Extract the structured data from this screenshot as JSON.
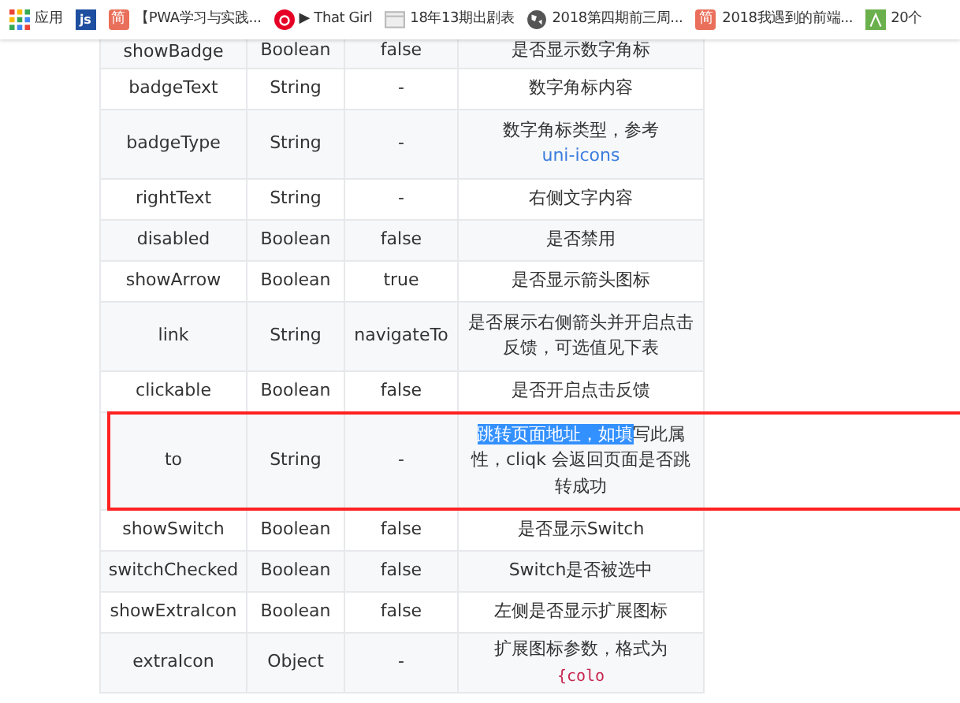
{
  "bookmarks": [
    {
      "kind": "apps",
      "label": "应用"
    },
    {
      "kind": "js",
      "label": "js"
    },
    {
      "kind": "jian",
      "label": "简"
    },
    {
      "kind": "text",
      "label": "【PWA学习与实践..."
    },
    {
      "kind": "music",
      "label": "▶ That Girl"
    },
    {
      "kind": "page",
      "label": "18年13期出剧表"
    },
    {
      "kind": "globe",
      "label": "2018第四期前三周..."
    },
    {
      "kind": "jian",
      "label": "简"
    },
    {
      "kind": "text",
      "label": "2018我遇到的前端..."
    },
    {
      "kind": "green",
      "label": "20个"
    }
  ],
  "table": {
    "rows": [
      {
        "name": "showBadge",
        "type": "Boolean",
        "default": "false",
        "description": "是否显示数字角标",
        "highlighted": false
      },
      {
        "name": "badgeText",
        "type": "String",
        "default": "-",
        "description": "数字角标内容",
        "highlighted": false
      },
      {
        "name": "badgeType",
        "type": "String",
        "default": "-",
        "description": "数字角标类型，参考",
        "link": "uni-icons",
        "highlighted": false
      },
      {
        "name": "rightText",
        "type": "String",
        "default": "-",
        "description": "右侧文字内容",
        "highlighted": false
      },
      {
        "name": "disabled",
        "type": "Boolean",
        "default": "false",
        "description": "是否禁用",
        "highlighted": false
      },
      {
        "name": "showArrow",
        "type": "Boolean",
        "default": "true",
        "description": "是否显示箭头图标",
        "highlighted": false
      },
      {
        "name": "link",
        "type": "String",
        "default": "navigateTo",
        "description": "是否展示右侧箭头并开启点击反馈，可选值见下表",
        "highlighted": false
      },
      {
        "name": "clickable",
        "type": "Boolean",
        "default": "false",
        "description": "是否开启点击反馈",
        "highlighted": false
      },
      {
        "name": "to",
        "type": "String",
        "default": "-",
        "selected_text": "跳转页面地址，如填",
        "description": "写此属性，cliqk 会返回页面是否跳转成功",
        "highlighted": true
      },
      {
        "name": "showSwitch",
        "type": "Boolean",
        "default": "false",
        "description": "是否显示Switch",
        "highlighted": false
      },
      {
        "name": "switchChecked",
        "type": "Boolean",
        "default": "false",
        "description": "Switch是否被选中",
        "highlighted": false
      },
      {
        "name": "showExtraIcon",
        "type": "Boolean",
        "default": "false",
        "description": "左侧是否显示扩展图标",
        "highlighted": false
      },
      {
        "name": "extraIcon",
        "type": "Object",
        "default": "-",
        "description": "扩展图标参数，格式为",
        "code": "{colo",
        "highlighted": false
      }
    ]
  }
}
